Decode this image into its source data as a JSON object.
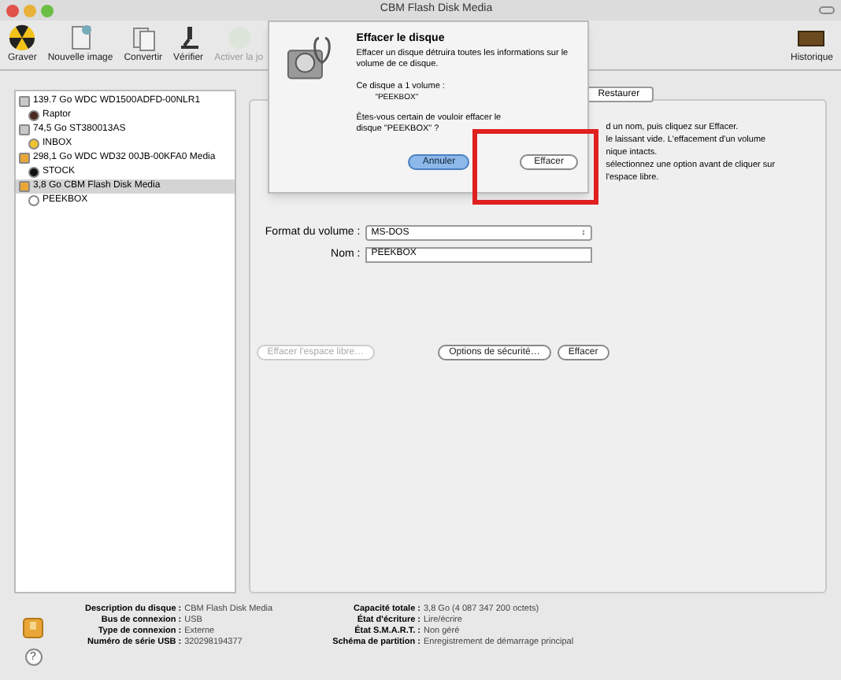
{
  "window": {
    "title": "CBM Flash Disk Media"
  },
  "toolbar": [
    {
      "label": "Graver",
      "kind": "burn",
      "disabled": false
    },
    {
      "label": "Nouvelle image",
      "kind": "image",
      "disabled": false
    },
    {
      "label": "Convertir",
      "kind": "convert",
      "disabled": false
    },
    {
      "label": "Vérifier",
      "kind": "verify",
      "disabled": false
    },
    {
      "label": "Activer la jo",
      "kind": "journal",
      "disabled": true
    },
    {
      "label": "Historique",
      "kind": "log",
      "disabled": false
    }
  ],
  "sidebar": {
    "items": [
      {
        "label": "139.7 Go WDC WD1500ADFD-00NLR1",
        "kind": "disk",
        "selected": false,
        "children": [
          {
            "label": "Raptor",
            "kind": "volume-dark",
            "selected": false
          }
        ]
      },
      {
        "label": "74,5 Go ST380013AS",
        "kind": "disk",
        "selected": false,
        "children": [
          {
            "label": "INBOX",
            "kind": "volume-yellow",
            "selected": false
          }
        ]
      },
      {
        "label": "298,1 Go WDC WD32 00JB-00KFA0 Media",
        "kind": "disk-orange",
        "selected": false,
        "children": [
          {
            "label": "STOCK",
            "kind": "volume-black",
            "selected": false
          }
        ]
      },
      {
        "label": "3,8 Go CBM Flash Disk Media",
        "kind": "disk-orange",
        "selected": true,
        "children": [
          {
            "label": "PEEKBOX",
            "kind": "volume-white",
            "selected": false
          }
        ]
      }
    ]
  },
  "main": {
    "tab": "Restaurer",
    "info_lines": [
      "d un nom, puis cliquez sur Effacer.",
      "le laissant vide. L'effacement d'un volume",
      "nique intacts.",
      "sélectionnez une option avant de cliquer sur",
      "l'espace libre."
    ],
    "format_label": "Format du volume :",
    "format_value": "MS-DOS",
    "format_arrows": "↕",
    "name_label": "Nom :",
    "name_value": "PEEKBOX",
    "buttons": [
      {
        "label": "Effacer l'espace libre…",
        "disabled": true
      },
      {
        "label": "Options de sécurité…",
        "disabled": false
      },
      {
        "label": "Effacer",
        "disabled": false
      }
    ]
  },
  "sheet": {
    "title": "Effacer le disque",
    "description": "Effacer un disque détruira toutes les informations sur le volume de ce disque.",
    "volume_count": "Ce disque a 1 volume :",
    "volume_name": "\"PEEKBOX\"",
    "question": "Êtes-vous certain de vouloir effacer le disque \"PEEKBOX\" ?",
    "buttons": [
      {
        "label": "Annuler",
        "default": true
      },
      {
        "label": "Effacer",
        "default": false
      }
    ]
  },
  "help_button": "?",
  "info": {
    "left": [
      {
        "key": "Description du disque :",
        "value": "CBM Flash Disk Media"
      },
      {
        "key": "Bus de connexion :",
        "value": "USB"
      },
      {
        "key": "Type de connexion :",
        "value": "Externe"
      },
      {
        "key": "Numéro de série USB :",
        "value": "320298194377"
      }
    ],
    "right": [
      {
        "key": "Capacité totale :",
        "value": "3,8 Go (4 087 347 200 octets)"
      },
      {
        "key": "État d'écriture :",
        "value": "Lire/écrire"
      },
      {
        "key": "État S.M.A.R.T. :",
        "value": "Non géré"
      },
      {
        "key": "Schéma de partition :",
        "value": "Enregistrement de démarrage principal"
      }
    ]
  }
}
